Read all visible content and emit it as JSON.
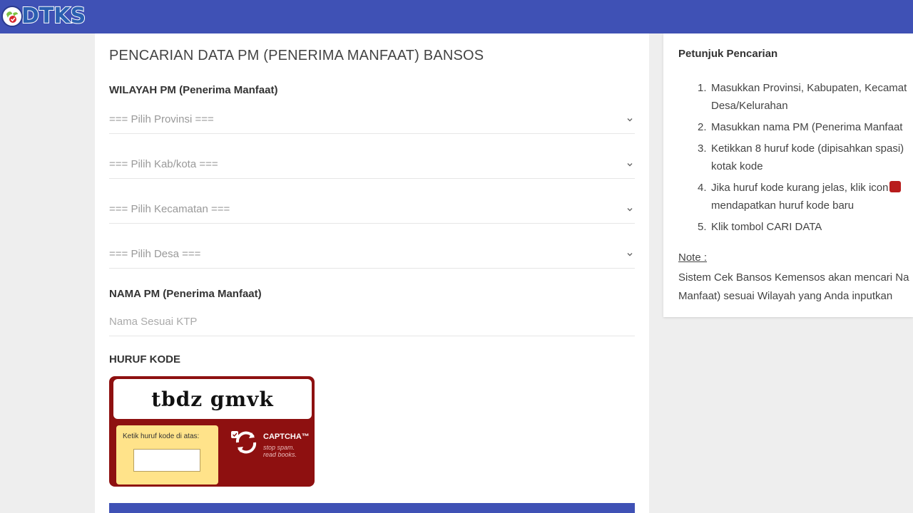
{
  "header": {
    "logo_text": "DTKS",
    "color": "#3f51b5"
  },
  "form": {
    "title": "PENCARIAN DATA PM (PENERIMA MANFAAT) BANSOS",
    "wilayah_label": "WILAYAH PM (Penerima Manfaat)",
    "provinsi": "=== Pilih Provinsi ===",
    "kabkota": "=== Pilih Kab/kota ===",
    "kecamatan": "=== Pilih Kecamatan ===",
    "desa": "=== Pilih Desa ===",
    "nama_label": "NAMA PM (Penerima Manfaat)",
    "nama_placeholder": "Nama Sesuai KTP",
    "kode_label": "HURUF KODE"
  },
  "captcha": {
    "challenge": "tbdz gmvk",
    "prompt": "Ketik huruf kode di atas:",
    "brand": "CAPTCHA™",
    "tagline1": "stop spam.",
    "tagline2": "read books.",
    "color": "#8e1010"
  },
  "sidebar": {
    "title": "Petunjuk Pencarian",
    "steps": [
      {
        "num": "1.",
        "line1": "Masukkan Provinsi, Kabupaten, Kecamat",
        "line2": "Desa/Kelurahan"
      },
      {
        "num": "2.",
        "line1": "Masukkan nama PM (Penerima Manfaat"
      },
      {
        "num": "3.",
        "line1": "Ketikkan 8 huruf kode (dipisahkan spasi)",
        "line2": "kotak kode"
      },
      {
        "num": "4.",
        "line1": "Jika huruf kode kurang jelas, klik icon",
        "line2": "mendapatkan huruf kode baru"
      },
      {
        "num": "5.",
        "line1": "Klik tombol CARI DATA"
      }
    ],
    "note_label": "Note :",
    "note_line1": "Sistem Cek Bansos Kemensos akan mencari Na",
    "note_line2": "Manfaat) sesuai Wilayah yang Anda inputkan"
  }
}
